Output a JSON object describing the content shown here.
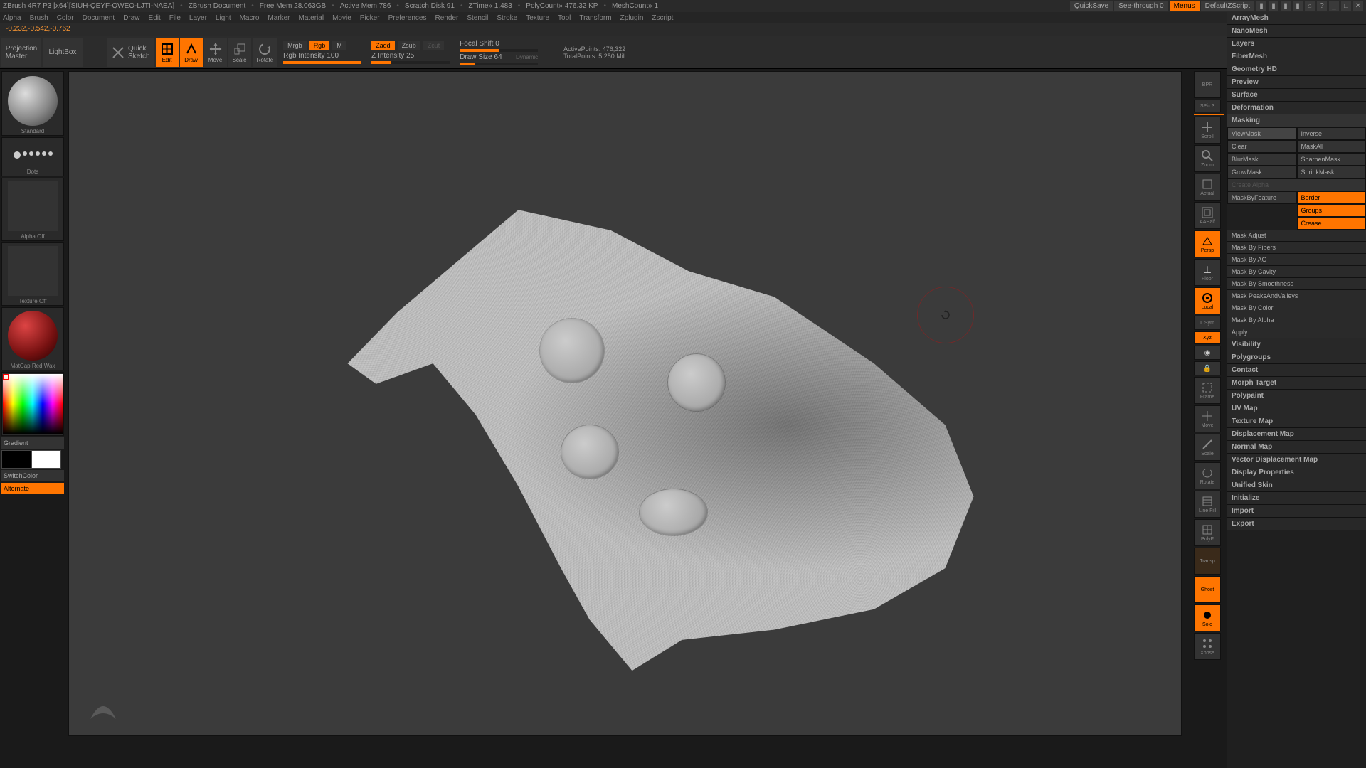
{
  "title": {
    "app": "ZBrush 4R7 P3 [x64][SIUH-QEYF-QWEO-LJTI-NAEA]",
    "doc": "ZBrush Document",
    "freemem": "Free Mem 28.063GB",
    "activemem": "Active Mem 786",
    "scratch": "Scratch Disk 91",
    "ztime": "ZTime» 1.483",
    "polycount": "PolyCount» 476.32 KP",
    "meshcount": "MeshCount» 1",
    "quicksave": "QuickSave",
    "seethrough": "See-through  0",
    "menus": "Menus",
    "defaultz": "DefaultZScript"
  },
  "menu": [
    "Alpha",
    "Brush",
    "Color",
    "Document",
    "Draw",
    "Edit",
    "File",
    "Layer",
    "Light",
    "Macro",
    "Marker",
    "Material",
    "Movie",
    "Picker",
    "Preferences",
    "Render",
    "Stencil",
    "Stroke",
    "Texture",
    "Tool",
    "Transform",
    "Zplugin",
    "Zscript"
  ],
  "coord": "-0.232,-0.542,-0.762",
  "toolbar": {
    "projection": "Projection\nMaster",
    "lightbox": "LightBox",
    "quicksketch": "Quick\nSketch",
    "edit": "Edit",
    "draw": "Draw",
    "move": "Move",
    "scale": "Scale",
    "rotate": "Rotate",
    "mrgb": "Mrgb",
    "rgb": "Rgb",
    "m": "M",
    "rgb_int": "Rgb Intensity 100",
    "zadd": "Zadd",
    "zsub": "Zsub",
    "zcut": "Zcut",
    "z_int": "Z Intensity 25",
    "focal": "Focal Shift 0",
    "drawsize": "Draw Size 64",
    "dynamic": "Dynamic",
    "activepoints": "ActivePoints: 476,322",
    "totalpoints": "TotalPoints: 5.250 Mil"
  },
  "left": {
    "brush": "Standard",
    "stroke": "Dots",
    "alpha": "Alpha Off",
    "texture": "Texture Off",
    "material": "MatCap Red Wax",
    "gradient": "Gradient",
    "switchcolor": "SwitchColor",
    "alternate": "Alternate"
  },
  "rview": {
    "bpr": "BPR",
    "spix": "SPix 3",
    "scroll": "Scroll",
    "zoom": "Zoom",
    "actual": "Actual",
    "aahalf": "AAHalf",
    "persp": "Persp",
    "floor": "Floor",
    "local": "Local",
    "lf": "L.Sym",
    "xyz": "Xyz",
    "frame": "Frame",
    "move": "Move",
    "scale": "Scale",
    "rotate": "Rotate",
    "linefill": "Line Fill",
    "polyf": "PolyF",
    "transp": "Transp",
    "ghost": "Ghost",
    "solo": "Solo",
    "xpose": "Xpose"
  },
  "rpanel": {
    "sections_top": [
      "ArrayMesh",
      "NanoMesh",
      "Layers",
      "FiberMesh",
      "Geometry HD",
      "Preview",
      "Surface",
      "Deformation"
    ],
    "masking_header": "Masking",
    "masking": {
      "viewmask": "ViewMask",
      "inverse": "Inverse",
      "clear": "Clear",
      "maskall": "MaskAll",
      "blurmask": "BlurMask",
      "sharpenmask": "SharpenMask",
      "growmask": "GrowMask",
      "shrinkmask": "ShrinkMask",
      "createalpha": "Create Alpha",
      "maskbyfeature": "MaskByFeature",
      "border": "Border",
      "groups": "Groups",
      "crease": "Crease",
      "items": [
        "Mask Adjust",
        "Mask By Fibers",
        "Mask By AO",
        "Mask By Cavity",
        "Mask By Smoothness",
        "Mask PeaksAndValleys",
        "Mask By Color",
        "Mask By Alpha",
        "Apply"
      ]
    },
    "sections_bottom": [
      "Visibility",
      "Polygroups",
      "Contact",
      "Morph Target",
      "Polypaint",
      "UV Map",
      "Texture Map",
      "Displacement Map",
      "Normal Map",
      "Vector Displacement Map",
      "Display Properties",
      "Unified Skin",
      "Initialize",
      "Import",
      "Export"
    ]
  }
}
